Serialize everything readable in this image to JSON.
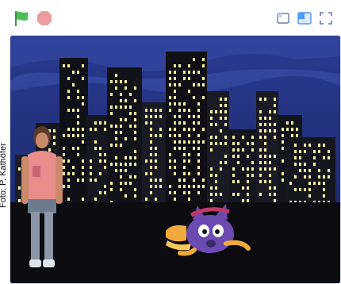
{
  "toolbar": {
    "green_flag": {
      "icon": "green-flag-icon",
      "color": "#4cbf56"
    },
    "stop": {
      "icon": "stop-icon",
      "color": "#ec9c9c"
    },
    "small_stage": {
      "icon": "small-stage-icon"
    },
    "large_stage": {
      "icon": "large-stage-icon"
    },
    "fullscreen": {
      "icon": "fullscreen-icon"
    }
  },
  "stage": {
    "backdrop": "night-city-skyline",
    "sky_color": "#2b3a8c",
    "ground_color": "#0b0b10",
    "window_color": "#f7f3a0",
    "sprites": [
      {
        "name": "girl-photo-sprite",
        "icon": "person-sprite"
      },
      {
        "name": "cat-sprite",
        "icon": "purple-cat-sprite",
        "color": "#6b4bb0"
      }
    ]
  },
  "credit": {
    "text": "Foto: P. Kathöfer"
  }
}
